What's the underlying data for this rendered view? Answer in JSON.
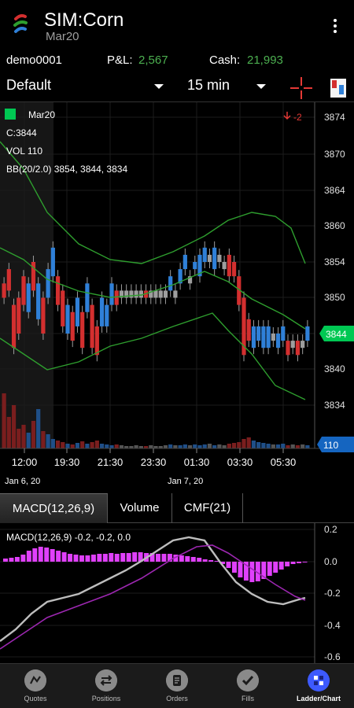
{
  "app": {
    "title": "SIM:Corn",
    "subtitle": "Mar20"
  },
  "account": {
    "id": "demo0001",
    "pnl_label": "P&L:",
    "pnl_value": "2,567",
    "cash_label": "Cash:",
    "cash_value": "21,993"
  },
  "controls": {
    "template": "Default",
    "interval": "15 min"
  },
  "main_chart": {
    "legend_name": "Mar20",
    "close_text": "C:3844",
    "volume_text": "VOL 110",
    "bb_text": "BB(20/2.0) 3854, 3844, 3834",
    "change_text": "-2",
    "y_ticks": [
      "3874",
      "3870",
      "3864",
      "3860",
      "3854",
      "3850",
      "3844",
      "3840",
      "3834"
    ],
    "last_price_tag": "3844",
    "volume_tag": "110",
    "x_ticks": [
      "12:00",
      "19:30",
      "21:30",
      "23:30",
      "01:30",
      "03:30",
      "05:30"
    ],
    "date_labels": [
      "Jan 6, 20",
      "Jan 7, 20"
    ],
    "colors": {
      "up": "#2f80d8",
      "down": "#d32f2f",
      "flat": "#9e9e9e",
      "band": "#2e9e2e",
      "price_tag": "#00c853",
      "volume_tag": "#1565c0"
    }
  },
  "indicator_tabs": [
    {
      "label": "MACD(12,26,9)",
      "active": true
    },
    {
      "label": "Volume",
      "active": false
    },
    {
      "label": "CMF(21)",
      "active": false
    }
  ],
  "macd_chart": {
    "legend_text": "MACD(12,26,9) -0.2, -0.2, 0.0",
    "y_ticks": [
      "0.2",
      "0.0",
      "-0.2",
      "-0.4",
      "-0.6"
    ],
    "colors": {
      "macd": "#bdbdbd",
      "signal": "#9c27b0",
      "histogram": "#e040fb"
    }
  },
  "bottom_nav": [
    {
      "label": "Quotes",
      "icon": "quotes-icon",
      "active": false
    },
    {
      "label": "Positions",
      "icon": "positions-icon",
      "active": false
    },
    {
      "label": "Orders",
      "icon": "orders-icon",
      "active": false
    },
    {
      "label": "Fills",
      "icon": "fills-icon",
      "active": false
    },
    {
      "label": "Ladder/Chart",
      "icon": "ladder-chart-icon",
      "active": true
    }
  ]
}
